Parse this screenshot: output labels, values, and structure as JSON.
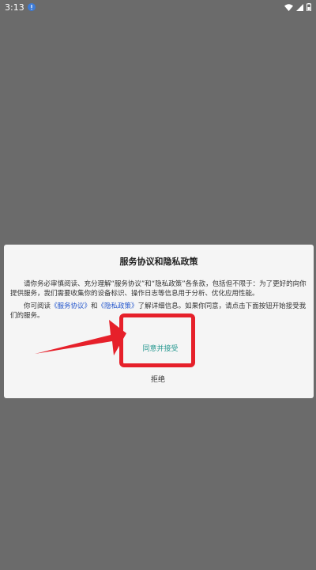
{
  "status_bar": {
    "time": "3:13"
  },
  "dialog": {
    "title": "服务协议和隐私政策",
    "para1": "请你务必审慎阅读、充分理解“服务协议”和“隐私政策”各条款，包括但不限于：为了更好的向你提供服务，我们需要收集你的设备标识、操作日志等信息用于分析、优化应用性能。",
    "para2_prefix": "你可阅读",
    "service_link": "《服务协议》",
    "para2_and": "和",
    "privacy_link": "《隐私政策》",
    "para2_suffix": "了解详细信息。如果你同意，请点击下面按钮开始接受我们的服务。",
    "agree_label": "同意并接受",
    "reject_label": "拒绝"
  },
  "colors": {
    "overlay": "#6b6b6b",
    "dialog_bg": "#f5f5f5",
    "link": "#2255cc",
    "agree": "#2a9a92",
    "annotation_red": "#e6202a"
  }
}
